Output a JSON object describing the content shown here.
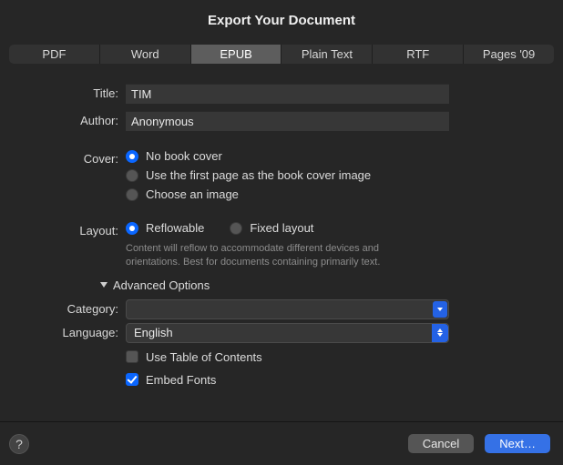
{
  "title": "Export Your Document",
  "tabs": {
    "pdf": "PDF",
    "word": "Word",
    "epub": "EPUB",
    "plain": "Plain Text",
    "rtf": "RTF",
    "pages09": "Pages '09"
  },
  "labels": {
    "title": "Title:",
    "author": "Author:",
    "cover": "Cover:",
    "layout": "Layout:",
    "category": "Category:",
    "language": "Language:"
  },
  "fields": {
    "title_value": "TIM",
    "author_value": "Anonymous",
    "category_value": "",
    "language_value": "English"
  },
  "cover": {
    "no_cover": "No book cover",
    "first_page": "Use the first page as the book cover image",
    "choose": "Choose an image"
  },
  "layout": {
    "reflowable": "Reflowable",
    "fixed": "Fixed layout",
    "hint": "Content will reflow to accommodate different devices and orientations. Best for documents containing primarily text."
  },
  "advanced_label": "Advanced Options",
  "checks": {
    "toc": "Use Table of Contents",
    "embed": "Embed Fonts"
  },
  "buttons": {
    "help": "?",
    "cancel": "Cancel",
    "next": "Next…"
  }
}
